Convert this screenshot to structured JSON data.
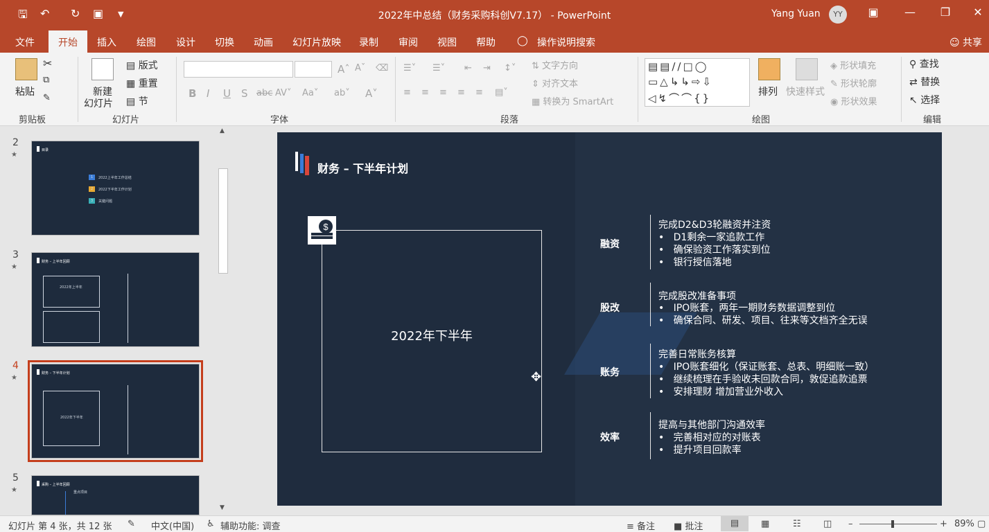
{
  "window": {
    "title": "2022年中总结（财务采购科创V7.17） - PowerPoint",
    "user_name": "Yang Yuan",
    "user_initials": "YY"
  },
  "tabs": [
    "文件",
    "开始",
    "插入",
    "绘图",
    "设计",
    "切换",
    "动画",
    "幻灯片放映",
    "录制",
    "审阅",
    "视图",
    "帮助",
    "操作说明搜索"
  ],
  "share_label": "共享",
  "ribbon": {
    "clipboard": {
      "paste": "粘贴",
      "group": "剪贴板"
    },
    "slides": {
      "new_slide_1": "新建",
      "new_slide_2": "幻灯片",
      "layout": "版式",
      "reset": "重置",
      "section": "节",
      "group": "幻灯片"
    },
    "font": {
      "group": "字体"
    },
    "paragraph": {
      "text_direction": "文字方向",
      "align_text": "对齐文本",
      "smartart": "转换为 SmartArt",
      "group": "段落"
    },
    "drawing": {
      "arrange": "排列",
      "quick_styles": "快速样式",
      "shape_fill": "形状填充",
      "shape_outline": "形状轮廓",
      "shape_effects": "形状效果",
      "group": "绘图"
    },
    "editing": {
      "find": "查找",
      "replace": "替换",
      "select": "选择",
      "group": "编辑"
    }
  },
  "thumbnails": [
    {
      "number": "2",
      "star": "★",
      "title": "目录",
      "items": [
        "2022上半年工作总结",
        "2022下半年工作计划",
        "关键问题"
      ]
    },
    {
      "number": "3",
      "star": "★",
      "title": "财务 – 上半年回顾",
      "frame_label": "2022年上半年"
    },
    {
      "number": "4",
      "star": "★",
      "title": "财务 – 下半年计划",
      "frame_label": "2022年下半年"
    },
    {
      "number": "5",
      "star": "★",
      "title": "采购 – 上半年回顾",
      "subtitle": "重点项目"
    }
  ],
  "slide": {
    "title": "财务 – 下半年计划",
    "frame_label": "2022年下半年",
    "sections": [
      {
        "category": "融资",
        "head": "完成D2&D3轮融资并注资",
        "bullets": [
          "D1剩余一家追款工作",
          "确保验资工作落实到位",
          "银行授信落地"
        ]
      },
      {
        "category": "股改",
        "head": "完成股改准备事项",
        "bullets": [
          "IPO账套，两年一期财务数据调整到位",
          "确保合同、研发、项目、往来等文档齐全无误"
        ]
      },
      {
        "category": "账务",
        "head": "完善日常账务核算",
        "bullets": [
          "IPO账套细化（保证账套、总表、明细账一致）",
          "继续梳理在手验收未回款合同，敦促追款追票",
          "安排理财 增加营业外收入"
        ]
      },
      {
        "category": "效率",
        "head": "提高与其他部门沟通效率",
        "bullets": [
          "完善相对应的对账表",
          "提升项目回款率"
        ]
      }
    ]
  },
  "statusbar": {
    "slide_info": "幻灯片 第 4 张，共 12 张",
    "language": "中文(中国)",
    "accessibility": "辅助功能: 调查",
    "notes": "备注",
    "comments": "批注",
    "zoom_percent": "89%",
    "zoom_level": 0.89
  },
  "colors": {
    "accent": "#b7472a",
    "slide_bg": "#1f2c3e",
    "selected_thumb": "#c43e1c"
  }
}
